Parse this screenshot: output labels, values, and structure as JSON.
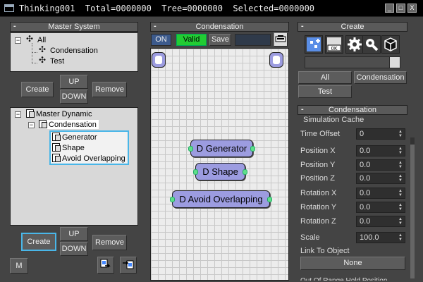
{
  "window": {
    "title": "Thinking001  Total=0000000  Tree=0000000  Selected=0000000",
    "minimize": "_",
    "maximize": "□",
    "close": "X"
  },
  "master_system": {
    "header": "Master System",
    "collapse": "-",
    "tree": {
      "root": "All",
      "children": [
        "Condensation",
        "Test"
      ]
    },
    "buttons": {
      "create": "Create",
      "up": "UP",
      "down": "DOWN",
      "remove": "Remove"
    }
  },
  "master_dynamic": {
    "tree": {
      "root": "Master Dynamic",
      "child": "Condensation",
      "items": [
        "Generator",
        "Shape",
        "Avoid Overlapping"
      ]
    },
    "buttons": {
      "create": "Create",
      "up": "UP",
      "down": "DOWN",
      "remove": "Remove",
      "m": "M"
    }
  },
  "graph_panel": {
    "header": "Condensation",
    "collapse": "-",
    "toolbar": {
      "on": "ON",
      "valid": "Valid",
      "save": "Save"
    },
    "nodes": [
      "D Generator",
      "D Shape",
      "D Avoid Overlapping"
    ]
  },
  "create_panel": {
    "header": "Create",
    "collapse": "-",
    "icons": [
      "add-node-icon",
      "add-counter-icon",
      "gear-icon",
      "wrench-icon",
      "cube-icon"
    ],
    "buttons": {
      "all": "All",
      "condensation": "Condensation",
      "test": "Test"
    }
  },
  "condensation_panel": {
    "header": "Condensation",
    "collapse": "-",
    "section": "Simulation Cache",
    "fields": [
      {
        "label": "Time Offset",
        "value": "0"
      },
      {
        "label": "Position X",
        "value": "0.0"
      },
      {
        "label": "Position Y",
        "value": "0.0"
      },
      {
        "label": "Position Z",
        "value": "0.0"
      },
      {
        "label": "Rotation X",
        "value": "0.0"
      },
      {
        "label": "Rotation Y",
        "value": "0.0"
      },
      {
        "label": "Rotation Z",
        "value": "0.0"
      },
      {
        "label": "Scale",
        "value": "100.0"
      }
    ],
    "link_label": "Link To Object",
    "link_button": "None",
    "cut_text": "Out Of Range Hold Position"
  },
  "colors": {
    "accent_focus": "#49b6e8",
    "valid_green": "#22cc33",
    "node_fill": "#9c9ce0",
    "port_green": "#5fdf8a"
  }
}
